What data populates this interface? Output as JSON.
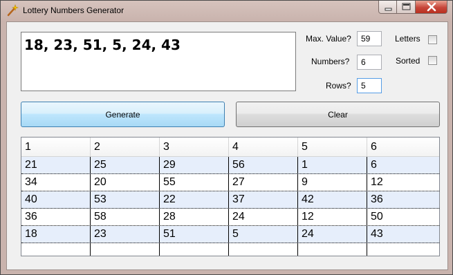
{
  "window": {
    "title": "Lottery Numbers Generator",
    "accent": "#c9b3ad",
    "close_color": "#c7463a"
  },
  "output": {
    "text": "18, 23, 51, 5, 24, 43"
  },
  "settings": {
    "max_value_label": "Max. Value?",
    "max_value": "59",
    "numbers_label": "Numbers?",
    "numbers": "6",
    "rows_label": "Rows?",
    "rows": "5",
    "letters_label": "Letters",
    "letters_checked": false,
    "sorted_label": "Sorted",
    "sorted_checked": false
  },
  "buttons": {
    "generate": "Generate",
    "clear": "Clear"
  },
  "grid": {
    "headers": [
      "1",
      "2",
      "3",
      "4",
      "5",
      "6"
    ],
    "rows": [
      [
        "21",
        "25",
        "29",
        "56",
        "1",
        "6"
      ],
      [
        "34",
        "20",
        "55",
        "27",
        "9",
        "12"
      ],
      [
        "40",
        "53",
        "22",
        "37",
        "42",
        "36"
      ],
      [
        "36",
        "58",
        "28",
        "24",
        "12",
        "50"
      ],
      [
        "18",
        "23",
        "51",
        "5",
        "24",
        "43"
      ],
      [
        "",
        "",
        "",
        "",
        "",
        ""
      ]
    ]
  }
}
